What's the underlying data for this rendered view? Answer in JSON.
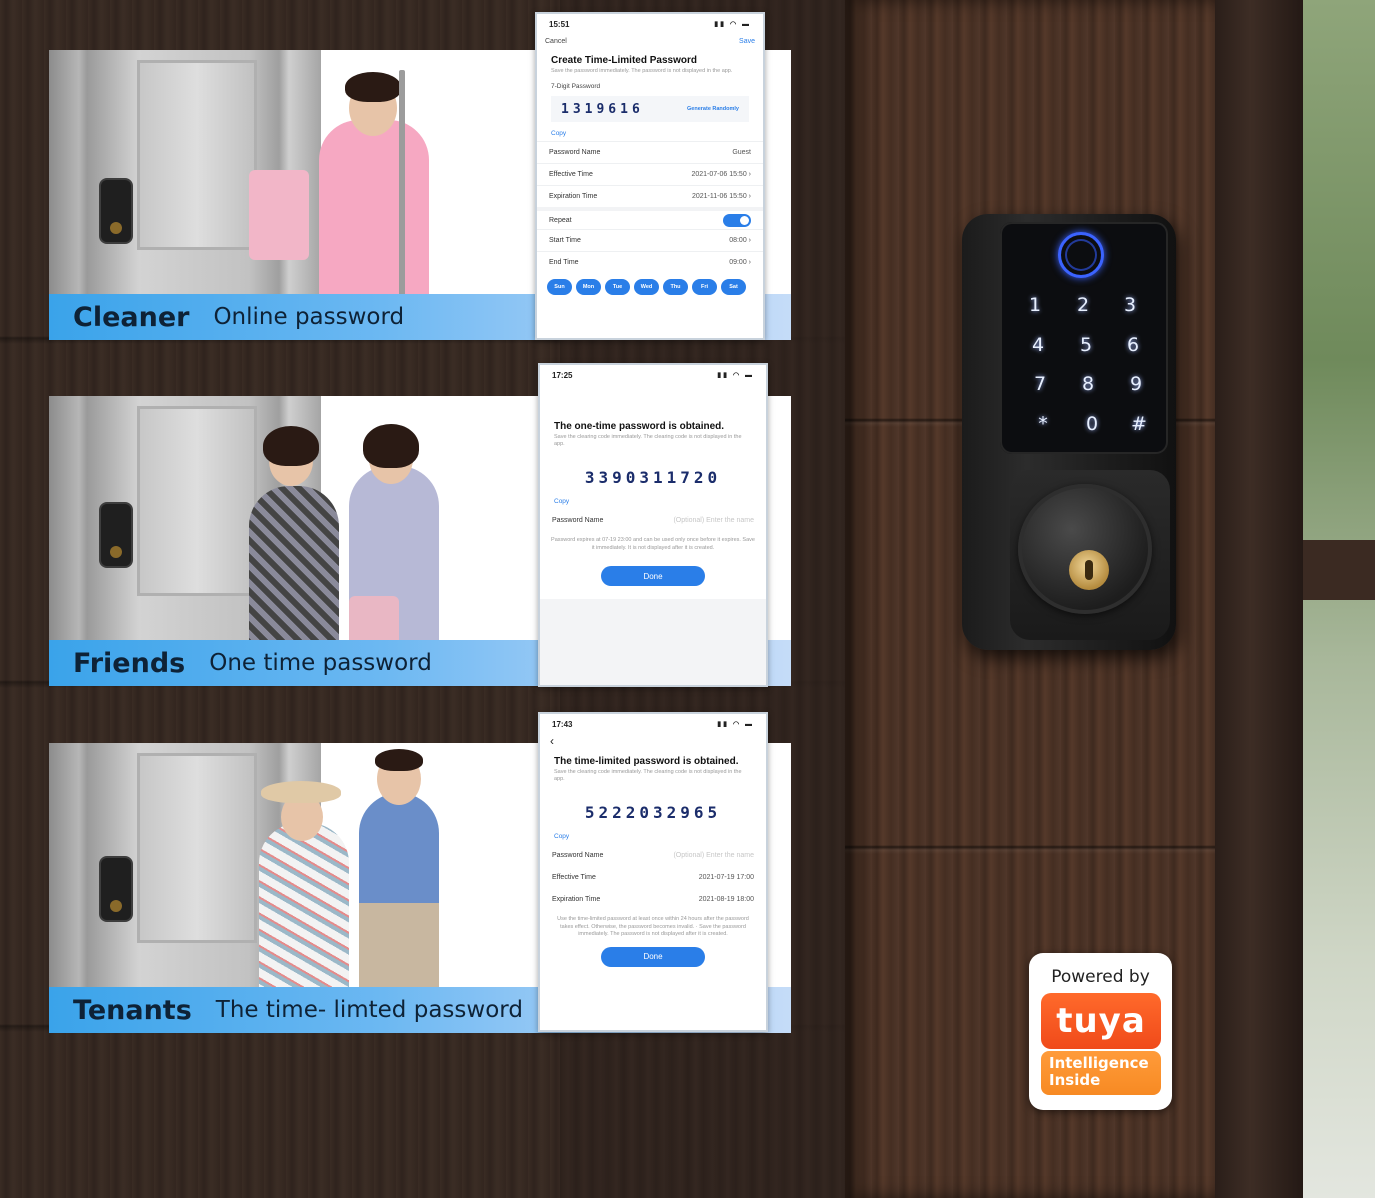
{
  "cards": [
    {
      "role": "Cleaner",
      "description": "Online password",
      "phone": {
        "time": "15:51",
        "status_icons": "▮▮ ◠ ▬",
        "cancel": "Cancel",
        "save": "Save",
        "title": "Create Time-Limited Password",
        "subtitle": "Save the password immediately. The password is not displayed in the app.",
        "code_label": "7-Digit Password",
        "code": "1319616",
        "generate": "Generate Randomly",
        "copy": "Copy",
        "rows": [
          {
            "label": "Password Name",
            "value": "Guest"
          },
          {
            "label": "Effective Time",
            "value": "2021-07-06 15:50 ›"
          },
          {
            "label": "Expiration Time",
            "value": "2021-11-06 15:50 ›"
          }
        ],
        "repeat_label": "Repeat",
        "rows2": [
          {
            "label": "Start Time",
            "value": "08:00 ›"
          },
          {
            "label": "End Time",
            "value": "09:00 ›"
          }
        ],
        "days": [
          "Sun",
          "Mon",
          "Tue",
          "Wed",
          "Thu",
          "Fri",
          "Sat"
        ]
      }
    },
    {
      "role": "Friends",
      "description": "One time password",
      "phone": {
        "time": "17:25",
        "status_icons": "▮▮ ◠ ▬",
        "title": "The one-time password is obtained.",
        "subtitle": "Save the clearing code immediately. The clearing code is not displayed in the app.",
        "code": "3390311720",
        "copy": "Copy",
        "name_label": "Password Name",
        "name_placeholder": "(Optional) Enter the name",
        "note": "Password expires at 07-19 23:00 and can be used only once before it expires. Save it immediately. It is not displayed after it is created.",
        "done": "Done"
      }
    },
    {
      "role": "Tenants",
      "description": "The time- limted password",
      "phone": {
        "time": "17:43",
        "status_icons": "▮▮ ◠ ▬",
        "back": "‹",
        "title": "The time-limited password is obtained.",
        "subtitle": "Save the clearing code immediately. The clearing code is not displayed in the app.",
        "code": "5222032965",
        "copy": "Copy",
        "name_label": "Password Name",
        "name_placeholder": "(Optional) Enter the name",
        "rows": [
          {
            "label": "Effective Time",
            "value": "2021-07-19 17:00"
          },
          {
            "label": "Expiration Time",
            "value": "2021-08-19 18:00"
          }
        ],
        "note": "Use the time-limited password at least once within 24 hours after the password takes effect. Otherwise, the password becomes invalid. · Save the password immediately. The password is not displayed after it is created.",
        "done": "Done"
      }
    }
  ],
  "lock": {
    "keys": [
      "1",
      "2",
      "3",
      "4",
      "5",
      "6",
      "7",
      "8",
      "9",
      "*",
      "0",
      "#"
    ]
  },
  "badge": {
    "powered_by": "Powered by",
    "brand": "tuya",
    "tagline_1": "Intelligence",
    "tagline_2": "Inside"
  },
  "colors": {
    "label_bar": "#3aa3ea",
    "accent": "#2a7ee8",
    "tuya_orange": "#f04a1a"
  }
}
